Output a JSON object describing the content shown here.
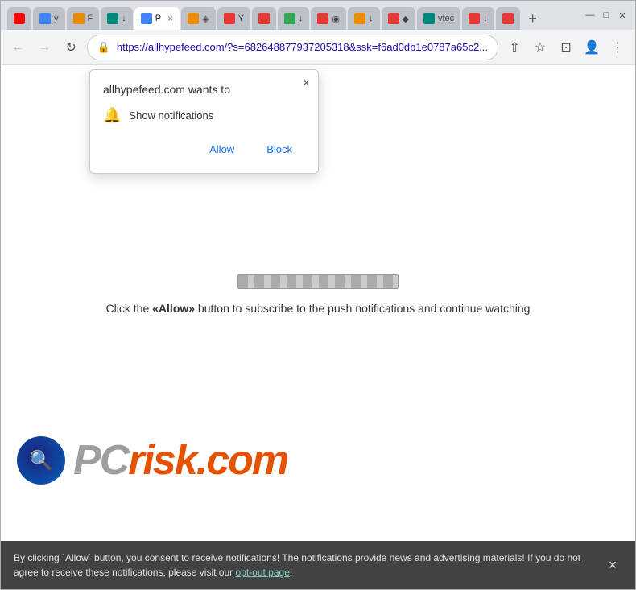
{
  "browser": {
    "tabs": [
      {
        "id": 1,
        "label": "",
        "favicon_color": "youtube",
        "active": false
      },
      {
        "id": 2,
        "label": "",
        "favicon_color": "blue",
        "active": false
      },
      {
        "id": 3,
        "label": "",
        "favicon_color": "orange",
        "active": false
      },
      {
        "id": 4,
        "label": "",
        "favicon_color": "teal",
        "active": false
      },
      {
        "id": 5,
        "label": "P ×",
        "favicon_color": "red",
        "active": true
      },
      {
        "id": 6,
        "label": "",
        "favicon_color": "orange",
        "active": false
      },
      {
        "id": 7,
        "label": "",
        "favicon_color": "green",
        "active": false
      },
      {
        "id": 8,
        "label": "",
        "favicon_color": "red",
        "active": false
      },
      {
        "id": 9,
        "label": "",
        "favicon_color": "blue",
        "active": false
      },
      {
        "id": 10,
        "label": "",
        "favicon_color": "orange",
        "active": false
      },
      {
        "id": 11,
        "label": "",
        "favicon_color": "darkred",
        "active": false
      },
      {
        "id": 12,
        "label": "",
        "favicon_color": "blue",
        "active": false
      },
      {
        "id": 13,
        "label": "vtec",
        "favicon_color": "teal",
        "active": false
      },
      {
        "id": 14,
        "label": "",
        "favicon_color": "red",
        "active": false
      },
      {
        "id": 15,
        "label": "",
        "favicon_color": "red",
        "active": false
      }
    ],
    "new_tab_label": "+",
    "window_controls": {
      "minimize": "—",
      "maximize": "□",
      "close": "✕"
    }
  },
  "toolbar": {
    "back_label": "←",
    "forward_label": "→",
    "reload_label": "↻",
    "address": "https://allhypefeed.com/?s=682648877937205318&ssk=f6ad0db1e0787a65c2...",
    "share_label": "⇧",
    "star_label": "☆",
    "tab_switch_label": "⊡",
    "profile_label": "👤",
    "menu_label": "⋮"
  },
  "notification_popup": {
    "title": "allhypefeed.com wants to",
    "close_label": "×",
    "permission_icon": "🔔",
    "permission_text": "Show notifications",
    "allow_label": "Allow",
    "block_label": "Block"
  },
  "page": {
    "instruction": "Click the «Allow» button to subscribe to the push notifications and continue watching",
    "instruction_bold": "Allow"
  },
  "pcrisk": {
    "text_gray": "PC",
    "text_orange": "risk.com"
  },
  "bottom_bar": {
    "text": "By clicking `Allow` button, you consent to receive notifications! The notifications provide news and advertising materials! If you do not agree to receive these notifications, please visit our ",
    "link_text": "opt-out page",
    "text_end": "!",
    "close_label": "×"
  }
}
